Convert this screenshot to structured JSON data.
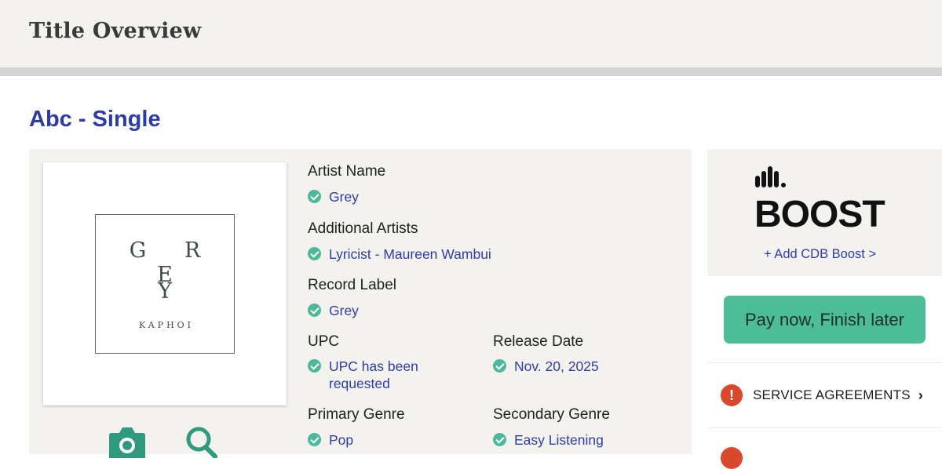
{
  "header": {
    "title": "Title Overview"
  },
  "release": {
    "title": "Abc - Single"
  },
  "artwork": {
    "line1": "G R E",
    "line2": "Y",
    "subtitle": "KAPHOI"
  },
  "artwork_actions": {
    "camera_icon": "camera-icon",
    "search_icon": "search-icon"
  },
  "fields": {
    "artist_name": {
      "label": "Artist Name",
      "value": "Grey"
    },
    "additional_artists": {
      "label": "Additional Artists",
      "value": "Lyricist - Maureen Wambui"
    },
    "record_label": {
      "label": "Record Label",
      "value": "Grey"
    },
    "upc": {
      "label": "UPC",
      "value": "UPC has been requested"
    },
    "release_date": {
      "label": "Release Date",
      "value": "Nov. 20, 2025"
    },
    "primary_genre": {
      "label": "Primary Genre",
      "value": "Pop"
    },
    "secondary_genre": {
      "label": "Secondary Genre",
      "value": "Easy Listening"
    }
  },
  "boost": {
    "brand": "BOOST",
    "link": "+ Add CDB Boost >"
  },
  "actions": {
    "pay_now": "Pay now, Finish later"
  },
  "checklist": [
    {
      "label": "SERVICE AGREEMENTS",
      "status": "!"
    }
  ],
  "colors": {
    "accent_blue": "#2e3da4",
    "check_green": "#4db89a",
    "button_green": "#4dbd98",
    "alert_red": "#d9482b"
  }
}
